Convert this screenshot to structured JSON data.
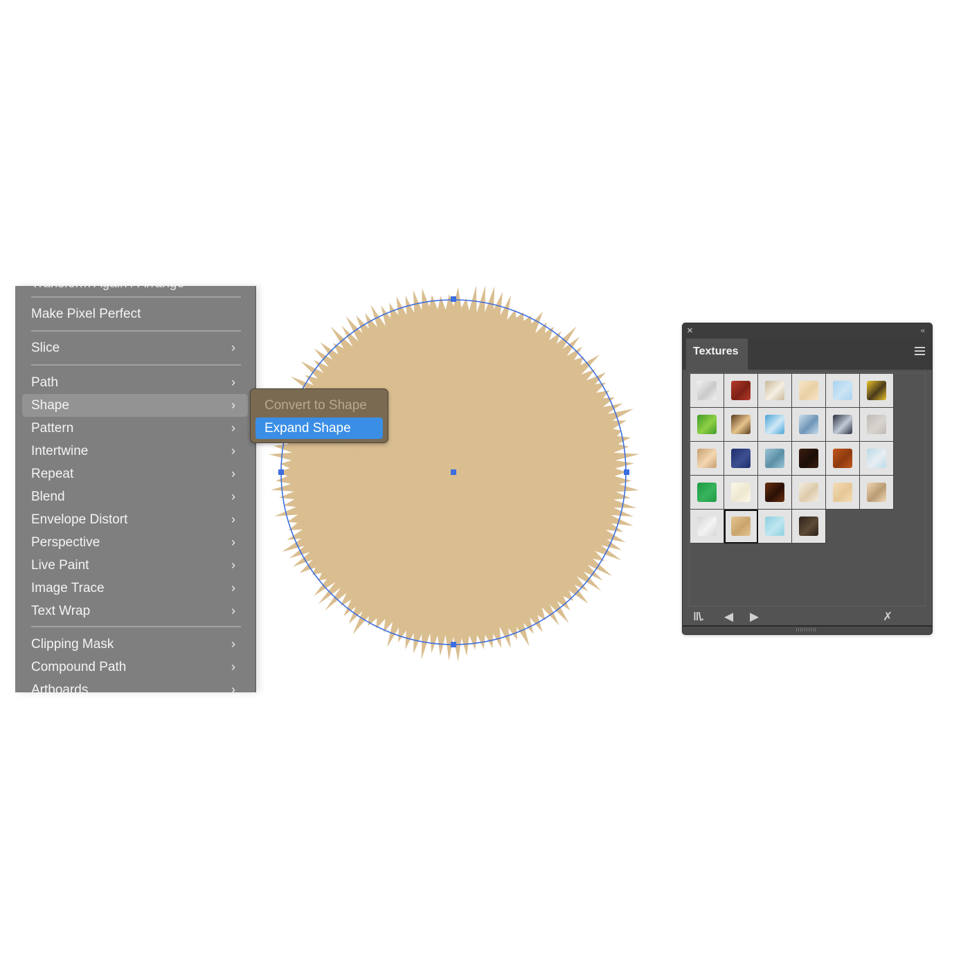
{
  "context_menu": {
    "truncated_top_item": "Transform Again / Arrange",
    "items": [
      {
        "label": "Make Pixel Perfect",
        "submenu": false
      },
      {
        "label": "Slice",
        "submenu": true
      },
      {
        "label": "Path",
        "submenu": true
      },
      {
        "label": "Shape",
        "submenu": true,
        "highlighted": true
      },
      {
        "label": "Pattern",
        "submenu": true
      },
      {
        "label": "Intertwine",
        "submenu": true
      },
      {
        "label": "Repeat",
        "submenu": true
      },
      {
        "label": "Blend",
        "submenu": true
      },
      {
        "label": "Envelope Distort",
        "submenu": true
      },
      {
        "label": "Perspective",
        "submenu": true
      },
      {
        "label": "Live Paint",
        "submenu": true
      },
      {
        "label": "Image Trace",
        "submenu": true
      },
      {
        "label": "Text Wrap",
        "submenu": true
      },
      {
        "label": "Clipping Mask",
        "submenu": true
      },
      {
        "label": "Compound Path",
        "submenu": true
      },
      {
        "label": "Artboards",
        "submenu": true
      }
    ],
    "chevron": "›"
  },
  "shape_submenu": {
    "items": [
      {
        "label": "Convert to Shape",
        "enabled": false
      },
      {
        "label": "Expand Shape",
        "enabled": true,
        "selected": true
      }
    ]
  },
  "canvas": {
    "shape_fill": "#dcc092",
    "selection_color": "#3d6ee0"
  },
  "textures_panel": {
    "close_icon": "×",
    "collapse_icon": "‹‹",
    "tab_label": "Textures",
    "menu_icon": "hamburger-icon",
    "swatches": [
      {
        "name": "white-silk",
        "colors": [
          "#f2f2f2",
          "#c9c9c9"
        ]
      },
      {
        "name": "red-brick",
        "colors": [
          "#b53a2a",
          "#7d2116"
        ]
      },
      {
        "name": "beige-brushed",
        "colors": [
          "#c8b89a",
          "#f5efe2"
        ]
      },
      {
        "name": "cream-grain",
        "colors": [
          "#f7e6c6",
          "#ead0a6"
        ]
      },
      {
        "name": "light-blue",
        "colors": [
          "#a9d2ef",
          "#cbe4f5"
        ]
      },
      {
        "name": "yellow-splatter",
        "colors": [
          "#e6c229",
          "#4b3a1c"
        ]
      },
      {
        "name": "green-grass",
        "colors": [
          "#3f9b2a",
          "#8fd044"
        ]
      },
      {
        "name": "brown-marble",
        "colors": [
          "#5a3d22",
          "#e8c48c"
        ]
      },
      {
        "name": "blue-ice",
        "colors": [
          "#4aa3d6",
          "#cfe9f7"
        ]
      },
      {
        "name": "blue-streaks",
        "colors": [
          "#c9dcea",
          "#6f96b8"
        ]
      },
      {
        "name": "stone-cells",
        "colors": [
          "#2b3040",
          "#c2cad6"
        ]
      },
      {
        "name": "gray-granite",
        "colors": [
          "#bfbab5",
          "#d8d4cf"
        ]
      },
      {
        "name": "cork-frame",
        "colors": [
          "#c79e6f",
          "#f3d7b3"
        ]
      },
      {
        "name": "navy-fabric",
        "colors": [
          "#1e2d6b",
          "#3d4f92"
        ]
      },
      {
        "name": "blue-weave",
        "colors": [
          "#9cc5d4",
          "#5c8fa5"
        ]
      },
      {
        "name": "dark-bark",
        "colors": [
          "#3b1e10",
          "#1c0e07"
        ]
      },
      {
        "name": "rust-orange",
        "colors": [
          "#c0561b",
          "#8e3a10"
        ]
      },
      {
        "name": "frosted-glass",
        "colors": [
          "#b9dbe8",
          "#e8eef3"
        ]
      },
      {
        "name": "green-grid",
        "colors": [
          "#1e9b45",
          "#36b35b"
        ]
      },
      {
        "name": "ivory-paper",
        "colors": [
          "#fbf8ea",
          "#eee8d0"
        ]
      },
      {
        "name": "burnt-wood",
        "colors": [
          "#6a2f10",
          "#2a1006"
        ]
      },
      {
        "name": "white-speckle",
        "colors": [
          "#f4ede0",
          "#ddcaaa"
        ]
      },
      {
        "name": "parchment",
        "colors": [
          "#f3dcb8",
          "#e6c796"
        ]
      },
      {
        "name": "wavy-paper",
        "colors": [
          "#f0d8b8",
          "#b99b72"
        ]
      },
      {
        "name": "silver-foil",
        "colors": [
          "#d5d5d5",
          "#f3f3f3"
        ]
      },
      {
        "name": "tan-crinkle",
        "colors": [
          "#e4c593",
          "#c9a46c"
        ],
        "selected": true
      },
      {
        "name": "aqua-watercolor",
        "colors": [
          "#8dcfe0",
          "#bfe6ef"
        ]
      },
      {
        "name": "dark-wood",
        "colors": [
          "#2c2218",
          "#5d4a36"
        ]
      }
    ],
    "footer_buttons": [
      {
        "name": "libraries-icon",
        "glyph": "ǁ\\."
      },
      {
        "name": "previous-icon",
        "glyph": "◀"
      },
      {
        "name": "next-icon",
        "glyph": "▶"
      },
      {
        "name": "remove-texture-icon",
        "glyph": "✗"
      }
    ]
  }
}
